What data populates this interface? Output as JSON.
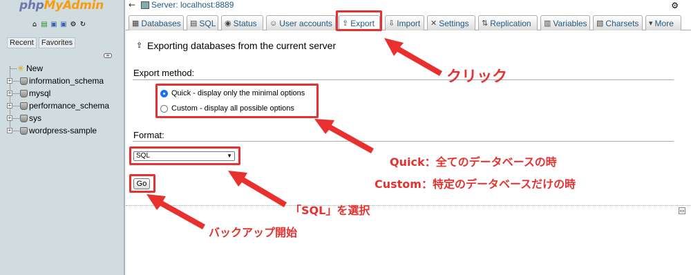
{
  "sidebar": {
    "logo": {
      "php": "php",
      "admin": "MyAdmin"
    },
    "nav_icons": [
      "home-icon",
      "logout-icon",
      "docs-icon",
      "help-icon",
      "settings-icon",
      "reload-icon"
    ],
    "tabs": [
      "Recent",
      "Favorites"
    ],
    "tree": [
      {
        "label": "New",
        "kind": "new"
      },
      {
        "label": "information_schema",
        "kind": "db"
      },
      {
        "label": "mysql",
        "kind": "db"
      },
      {
        "label": "performance_schema",
        "kind": "db"
      },
      {
        "label": "sys",
        "kind": "db"
      },
      {
        "label": "wordpress-sample",
        "kind": "db"
      }
    ]
  },
  "breadcrumb": {
    "server": "Server: localhost:8889"
  },
  "tabs": [
    {
      "label": "Databases",
      "icon": "databases-icon"
    },
    {
      "label": "SQL",
      "icon": "sql-icon"
    },
    {
      "label": "Status",
      "icon": "status-icon"
    },
    {
      "label": "User accounts",
      "icon": "users-icon"
    },
    {
      "label": "Export",
      "icon": "export-icon",
      "active": true
    },
    {
      "label": "Import",
      "icon": "import-icon"
    },
    {
      "label": "Settings",
      "icon": "settings-icon"
    },
    {
      "label": "Replication",
      "icon": "replication-icon"
    },
    {
      "label": "Variables",
      "icon": "variables-icon"
    },
    {
      "label": "Charsets",
      "icon": "charsets-icon"
    },
    {
      "label": "More",
      "icon": "chevron-down-icon"
    }
  ],
  "main": {
    "heading": "Exporting databases from the current server",
    "export_method": {
      "legend": "Export method:",
      "options": [
        {
          "label": "Quick - display only the minimal options",
          "selected": true
        },
        {
          "label": "Custom - display all possible options",
          "selected": false
        }
      ]
    },
    "format": {
      "legend": "Format:",
      "selected": "SQL"
    },
    "go_label": "Go"
  },
  "annotations": {
    "click": "クリック",
    "quick": "Quick：全てのデータベースの時",
    "custom": "Custom：特定のデータベースだけの時",
    "select_sql": "「SQL」を選択",
    "backup_start": "バックアップ開始",
    "color": "#e8312f"
  }
}
